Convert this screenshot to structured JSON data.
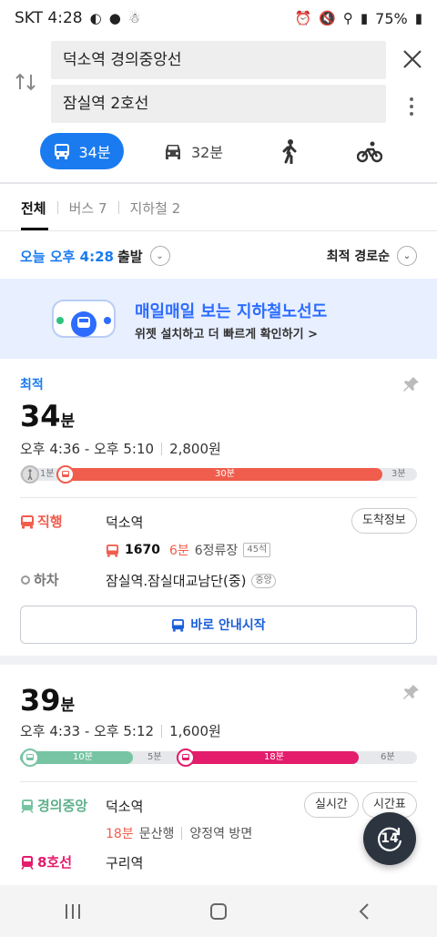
{
  "status_bar": {
    "carrier_time": "SKT 4:28",
    "battery": "75%"
  },
  "search": {
    "from": "덕소역 경의중앙선",
    "to": "잠실역 2호선"
  },
  "modes": {
    "transit_time": "34분",
    "car_time": "32분"
  },
  "filter_tabs": {
    "all": "전체",
    "bus": "버스 7",
    "subway": "지하철 2"
  },
  "depart": {
    "time": "오늘 오후 4:28",
    "label": "출발",
    "sort": "최적 경로순"
  },
  "banner": {
    "title": "매일매일 보는 지하철노선도",
    "subtitle": "위젯 설치하고 더 빠르게 확인하기 >"
  },
  "colors": {
    "accent": "#1a7bf0",
    "bus_red": "#f05d4d",
    "gyeongui": "#77c4a3",
    "line8": "#e31c6c"
  },
  "route1": {
    "badge": "최적",
    "duration_num": "34",
    "duration_unit": "분",
    "time_range": "오후 4:36 - 오후 5:10",
    "fare": "2,800원",
    "bar": {
      "walk1": "1분",
      "bus": "30분",
      "walk2": "3분"
    },
    "leg1": {
      "mode": "직행",
      "station": "덕소역",
      "arrival_btn": "도착정보",
      "bus_no": "1670",
      "wait": "6분",
      "stops": "6정류장",
      "seats": "45석"
    },
    "leg2": {
      "mode": "하차",
      "station": "잠실역.잠실대교남단(중)",
      "tag": "중앙"
    },
    "start_btn": "바로 안내시작"
  },
  "route2": {
    "duration_num": "39",
    "duration_unit": "분",
    "time_range": "오후 4:33 - 오후 5:12",
    "fare": "1,600원",
    "bar": {
      "subway1": "10분",
      "gap": "5분",
      "subway2": "18분",
      "walk": "6분"
    },
    "leg1": {
      "mode": "경의중앙",
      "station": "덕소역",
      "realtime_btn": "실시간",
      "timetable_btn": "시간표",
      "wait": "18분",
      "direction": "문산행",
      "platform": "양정역 방면"
    },
    "leg2": {
      "mode": "8호선",
      "station": "구리역"
    }
  },
  "fab": {
    "label": "14"
  }
}
